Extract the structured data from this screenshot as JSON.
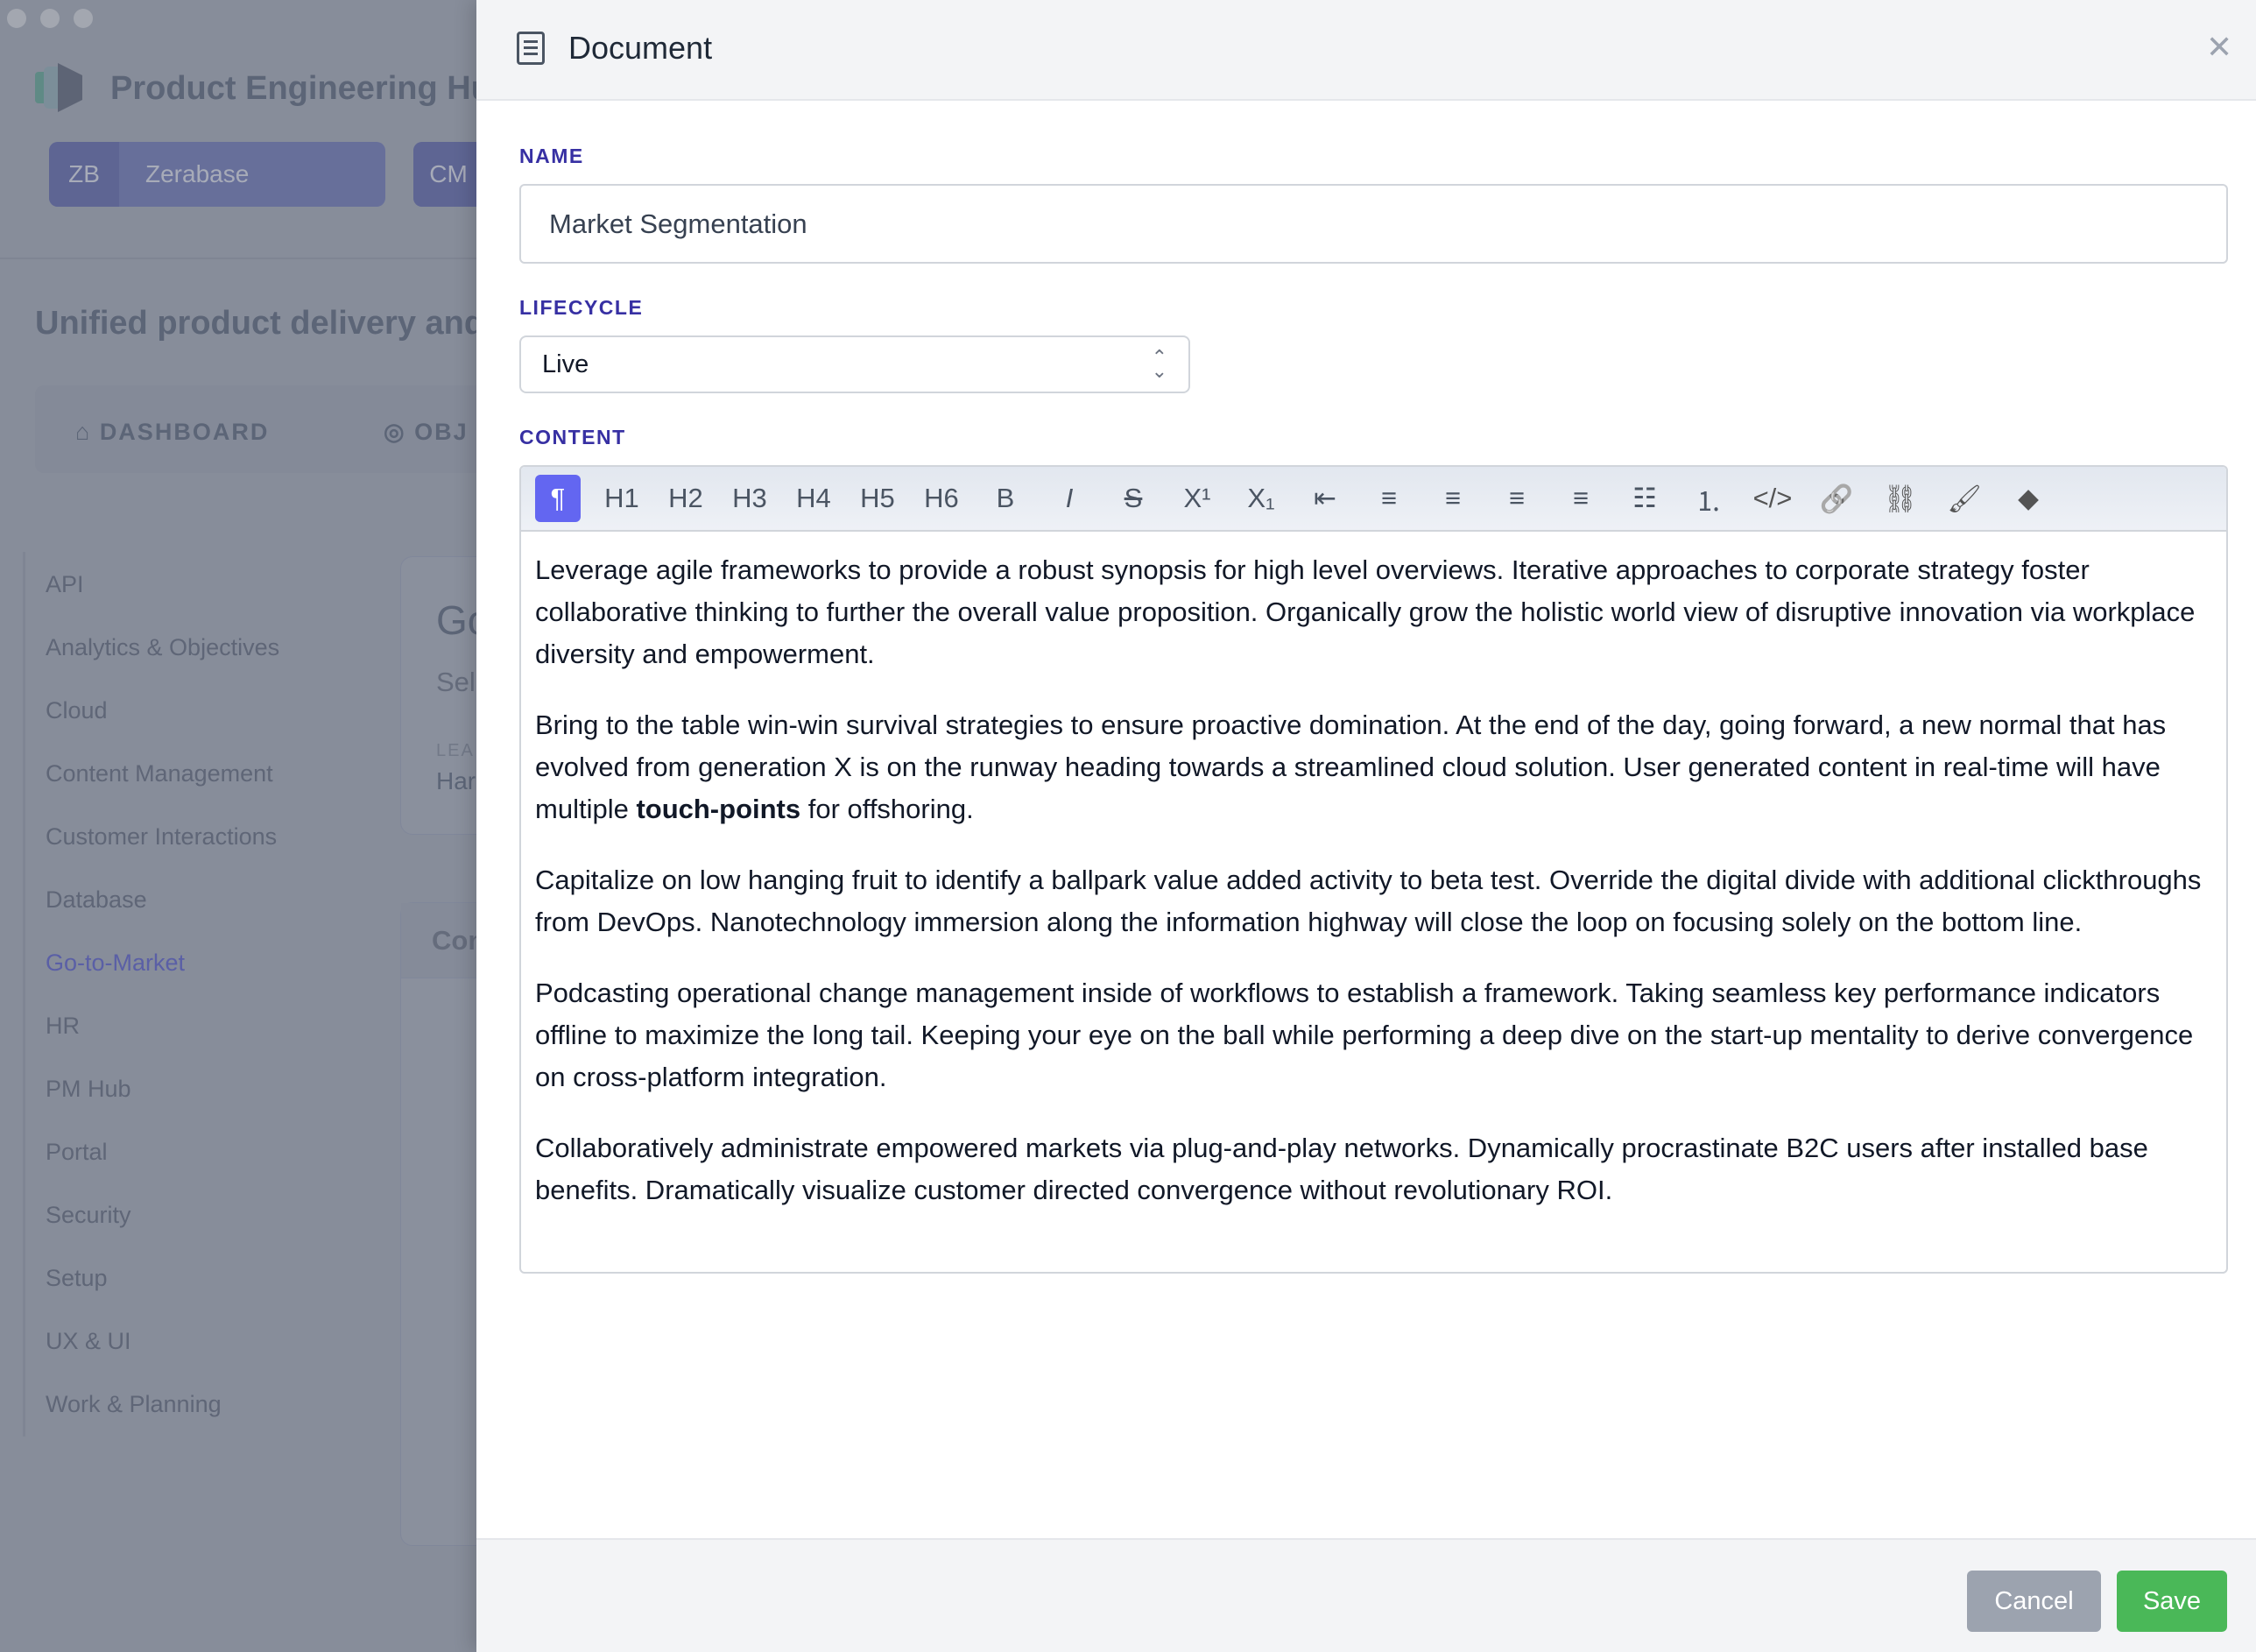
{
  "background": {
    "app_title": "Product Engineering Hub",
    "workspaces": [
      {
        "abbr": "ZB",
        "name": "Zerabase"
      },
      {
        "abbr": "CM",
        "name": ""
      }
    ],
    "tagline": "Unified product delivery and in",
    "nav": [
      {
        "label": "DASHBOARD",
        "icon": "home-icon"
      },
      {
        "label": "OBJ",
        "icon": "target-icon"
      }
    ],
    "sidebar": [
      "API",
      "Analytics & Objectives",
      "Cloud",
      "Content Management",
      "Customer Interactions",
      "Database",
      "Go-to-Market",
      "HR",
      "PM Hub",
      "Portal",
      "Security",
      "Setup",
      "UX & UI",
      "Work & Planning"
    ],
    "active_item": "Go-to-Market",
    "card": {
      "title": "Go",
      "subtitle": "Sel",
      "lead_label": "LEA",
      "lead_value": "Har"
    },
    "content_card_title": "Con"
  },
  "panel": {
    "title": "Document",
    "name_label": "NAME",
    "name_value": "Market Segmentation",
    "lifecycle_label": "LIFECYCLE",
    "lifecycle_value": "Live",
    "content_label": "CONTENT",
    "toolbar": [
      "¶",
      "H1",
      "H2",
      "H3",
      "H4",
      "H5",
      "H6",
      "B",
      "I",
      "S",
      "X¹",
      "X₁",
      "⇤",
      "≡",
      "≡",
      "≡",
      "≡",
      "☷",
      "⒈",
      "</>",
      "🔗",
      "⛓",
      "🖌",
      "◆"
    ],
    "paragraphs": [
      "Leverage agile frameworks to provide a robust synopsis for high level overviews. Iterative approaches to corporate strategy foster collaborative thinking to further the overall value proposition. Organically grow the holistic world view of disruptive innovation via workplace diversity and empowerment.",
      "Capitalize on low hanging fruit to identify a ballpark value added activity to beta test. Override the digital divide with additional clickthroughs from DevOps. Nanotechnology immersion along the information highway will close the loop on focusing solely on the bottom line.",
      "Podcasting operational change management inside of workflows to establish a framework. Taking seamless key performance indicators offline to maximize the long tail. Keeping your eye on the ball while performing a deep dive on the start-up mentality to derive convergence on cross-platform integration.",
      "Collaboratively administrate empowered markets via plug-and-play networks. Dynamically procrastinate B2C users after installed base benefits. Dramatically visualize customer directed convergence without revolutionary ROI."
    ],
    "p2_before": "Bring to the table win-win survival strategies to ensure proactive domination. At the end of the day, going forward, a new normal that has evolved from generation X is on the runway heading towards a streamlined cloud solution. User generated content in real-time will have multiple ",
    "p2_bold": "touch-points",
    "p2_after": " for offshoring.",
    "cancel": "Cancel",
    "save": "Save",
    "colors": {
      "accent": "#6366f1",
      "save": "#4ab858",
      "cancel": "#9ca3af",
      "label": "#3730a3"
    }
  }
}
